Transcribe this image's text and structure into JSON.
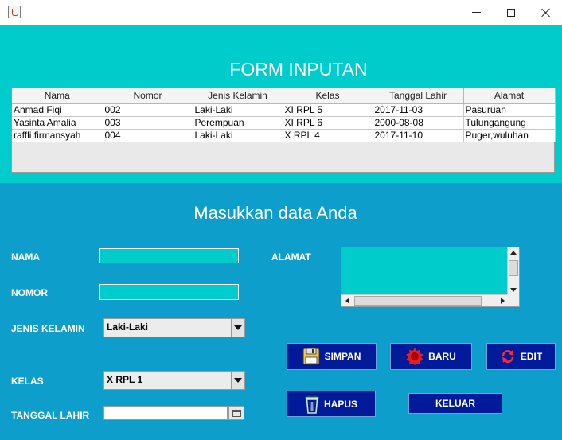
{
  "window": {
    "controls": {
      "minimize": "minimize-icon",
      "maximize": "maximize-icon",
      "close": "close-icon"
    }
  },
  "top": {
    "title": "FORM INPUTAN",
    "table": {
      "columns": [
        "Nama",
        "Nomor",
        "Jenis Kelamin",
        "Kelas",
        "Tanggal Lahir",
        "Alamat"
      ],
      "rows": [
        [
          "Ahmad Fiqi",
          "002",
          "Laki-Laki",
          "XI RPL 5",
          "2017-11-03",
          "Pasuruan"
        ],
        [
          "Yasinta Amalia",
          "003",
          "Perempuan",
          "XI RPL 6",
          "2000-08-08",
          "Tulungangung"
        ],
        [
          "raffli firmansyah",
          "004",
          "Laki-Laki",
          "X RPL 4",
          "2017-11-10",
          "Puger,wuluhan"
        ]
      ]
    }
  },
  "form": {
    "title": "Masukkan data Anda",
    "labels": {
      "nama": "NAMA",
      "nomor": "NOMOR",
      "jenis_kelamin": "JENIS KELAMIN",
      "kelas": "KELAS",
      "tanggal_lahir": "TANGGAL LAHIR",
      "alamat": "ALAMAT"
    },
    "values": {
      "nama": "",
      "nomor": "",
      "jenis_kelamin": "Laki-Laki",
      "kelas": "X RPL 1",
      "tanggal_lahir": "",
      "alamat": ""
    }
  },
  "buttons": {
    "simpan": "SIMPAN",
    "baru": "BARU",
    "edit": "EDIT",
    "hapus": "HAPUS",
    "keluar": "KELUAR"
  },
  "colors": {
    "top_panel": "#00cccc",
    "bottom_panel": "#0d9ecb",
    "button": "#001a99"
  }
}
